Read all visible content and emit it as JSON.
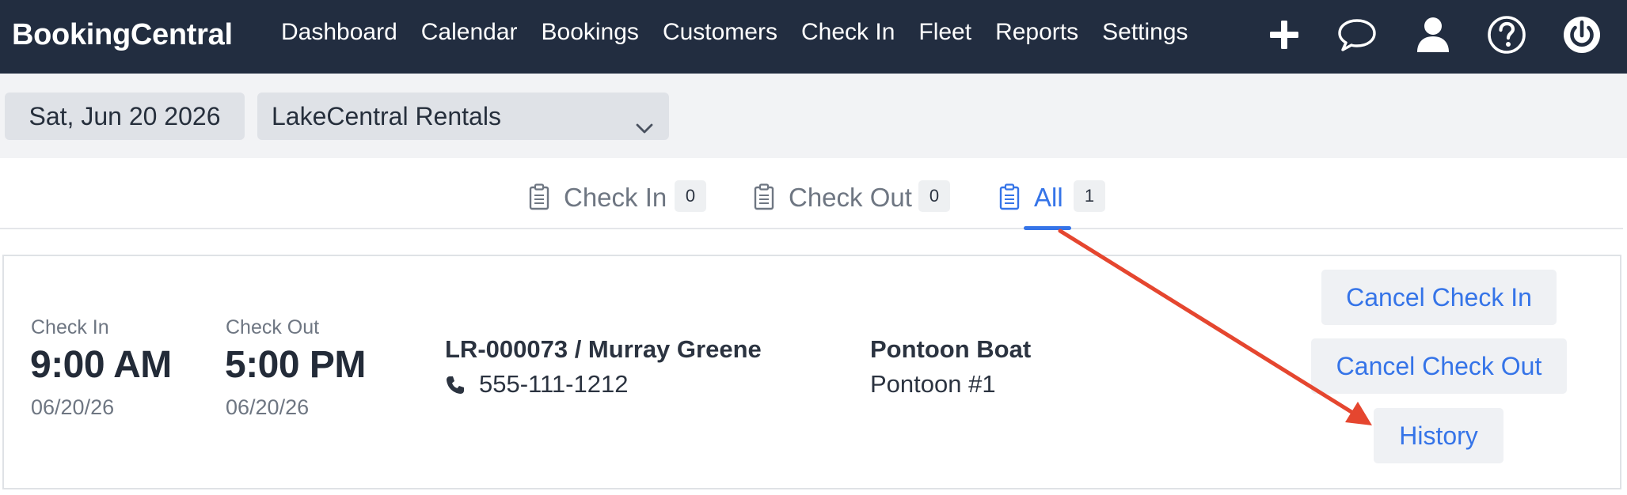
{
  "app": {
    "brand": "BookingCentral"
  },
  "nav": {
    "items": [
      "Dashboard",
      "Calendar",
      "Bookings",
      "Customers",
      "Check In",
      "Fleet",
      "Reports",
      "Settings"
    ]
  },
  "toolbar_icons": [
    "plus-icon",
    "chat-bubble-icon",
    "user-icon",
    "help-icon",
    "power-icon"
  ],
  "filters": {
    "date": "Sat, Jun 20 2026",
    "location": "LakeCentral Rentals"
  },
  "tabs": [
    {
      "label": "Check In",
      "count": "0",
      "active": false
    },
    {
      "label": "Check Out",
      "count": "0",
      "active": false
    },
    {
      "label": "All",
      "count": "1",
      "active": true
    }
  ],
  "booking": {
    "checkin_label": "Check In",
    "checkin_time": "9:00 AM",
    "checkin_date": "06/20/26",
    "checkout_label": "Check Out",
    "checkout_time": "5:00 PM",
    "checkout_date": "06/20/26",
    "reference": "LR-000073 / Murray Greene",
    "phone": "555-111-1212",
    "asset_type": "Pontoon Boat",
    "asset_name": "Pontoon #1"
  },
  "actions": {
    "cancel_checkin": "Cancel Check In",
    "cancel_checkout": "Cancel Check Out",
    "history": "History"
  },
  "colors": {
    "nav_bg": "#222d40",
    "accent": "#3574e8",
    "annotation_arrow": "#e5462f"
  }
}
